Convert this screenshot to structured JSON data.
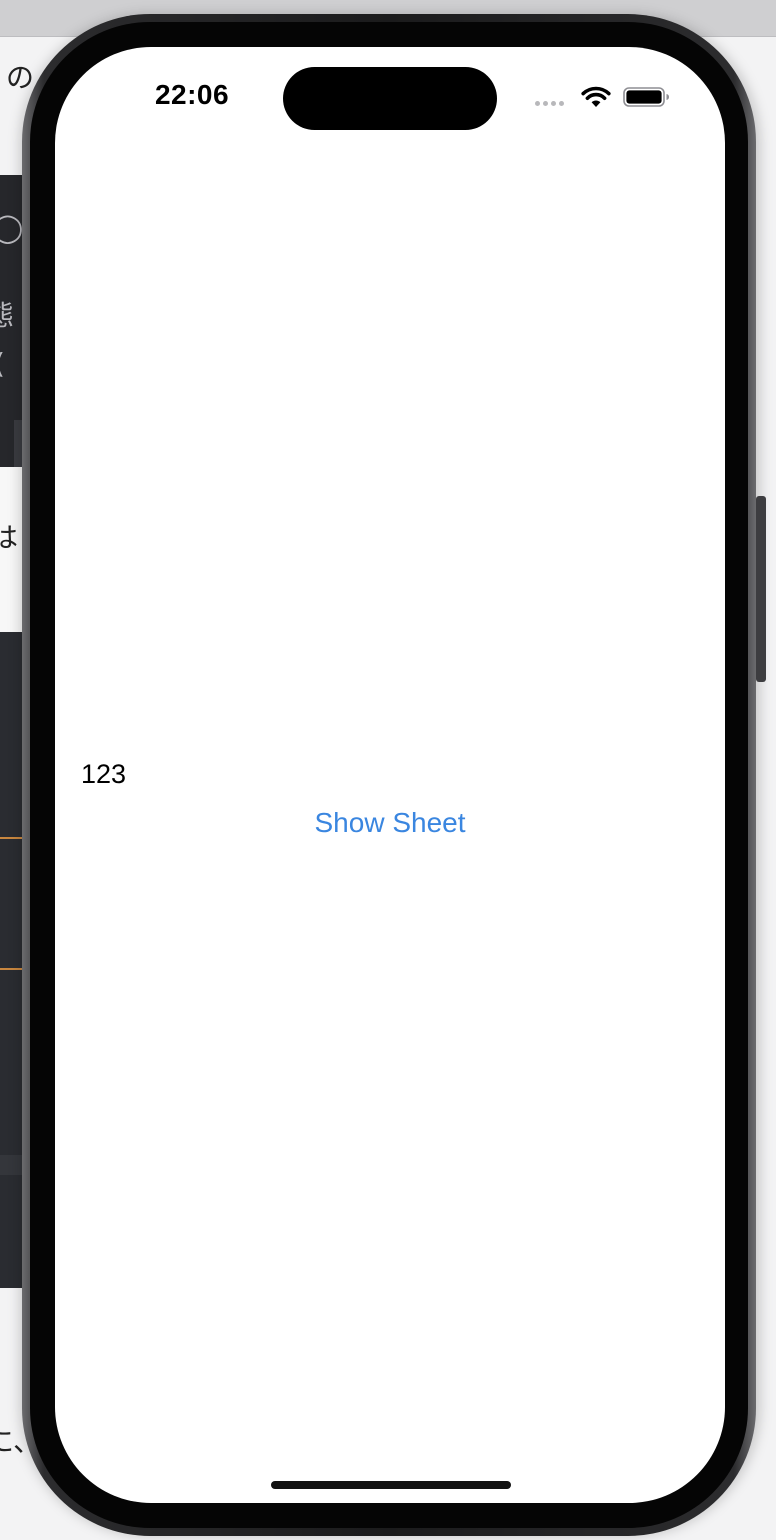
{
  "status_bar": {
    "time": "22:06",
    "icons": [
      "cellular-signal-icon",
      "wifi-icon",
      "battery-icon"
    ]
  },
  "content": {
    "count_text": "123",
    "show_sheet_label": "Show Sheet"
  },
  "background_page": {
    "text_fragments": [
      "の",
      "◯",
      "態",
      "(",
      "は",
      "に、"
    ]
  },
  "colors": {
    "accent": "#3a86e0",
    "screen_background": "#ffffff",
    "frame": "#1b1b1c",
    "background_dark": "#2a2c31",
    "background_accent_line": "#c9873f"
  }
}
